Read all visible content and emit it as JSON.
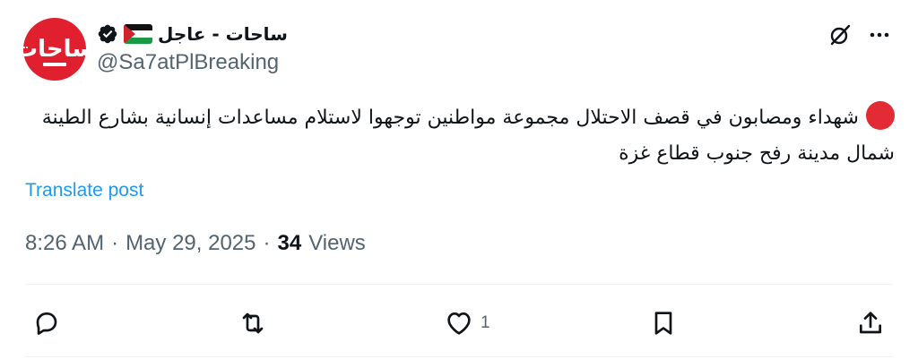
{
  "author": {
    "display_name": "ساحات - عاجل",
    "handle": "@Sa7atPlBreaking",
    "avatar_text": "ساحات",
    "verified_icon": "verified-badge-icon",
    "flag_icon": "palestine-flag-icon"
  },
  "tweet": {
    "text": "شهداء ومصابون في قصف الاحتلال مجموعة مواطنين توجهوا لاستلام مساعدات إنسانية بشارع الطينة شمال مدينة رفح جنوب قطاع غزة",
    "translate_label": "Translate post"
  },
  "meta": {
    "time": "8:26 AM",
    "date": "May 29, 2025",
    "views_count": "34",
    "views_label": "Views"
  },
  "actions": {
    "like_count": "1"
  },
  "colors": {
    "accent": "#1d9bf0",
    "brand_red": "#e0202e",
    "secondary_text": "#536471"
  }
}
